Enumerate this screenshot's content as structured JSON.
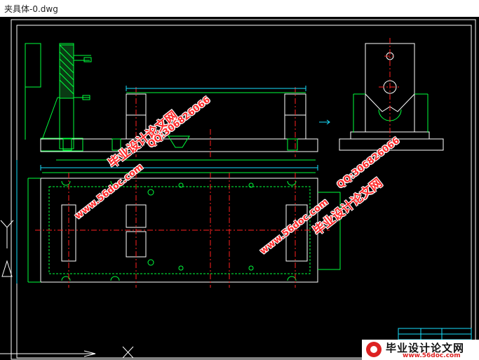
{
  "window": {
    "title": "夹具体-0.dwg"
  },
  "drawing": {
    "colors": {
      "background": "#000000",
      "outline": "#ffffff",
      "geometry": "#00ff3c",
      "centerline": "#ff2020",
      "dimension": "#18e0ff"
    }
  },
  "watermarks": {
    "site_cn": "毕业设计论文网",
    "qq": "QQ:306826066",
    "url": "www.56doc.com"
  },
  "logo": {
    "name": "毕业设计论文网",
    "url": "www.56doc.com"
  }
}
